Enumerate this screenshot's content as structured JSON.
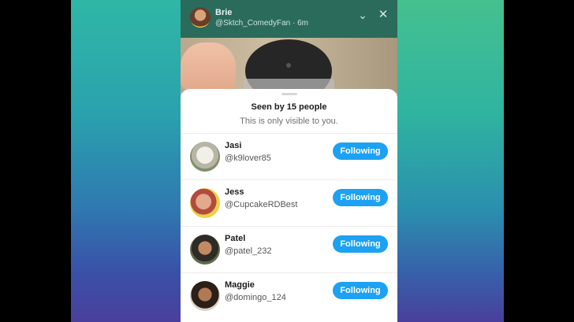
{
  "story": {
    "author_name": "Brie",
    "author_meta": "@Sktch_ComedyFan · 6m"
  },
  "sheet": {
    "title": "Seen by 15 people",
    "subtitle": "This is only visible to you."
  },
  "viewers": [
    {
      "name": "Jasi",
      "handle": "@k9lover85",
      "button": "Following"
    },
    {
      "name": "Jess",
      "handle": "@CupcakeRDBest",
      "button": "Following"
    },
    {
      "name": "Patel",
      "handle": "@patel_232",
      "button": "Following"
    },
    {
      "name": "Maggie",
      "handle": "@domingo_124",
      "button": "Following"
    }
  ],
  "colors": {
    "accent": "#1da1f2",
    "header_bg": "#2a6b5c"
  },
  "icons": {
    "collapse": "chevron-down-icon",
    "close": "close-icon"
  }
}
